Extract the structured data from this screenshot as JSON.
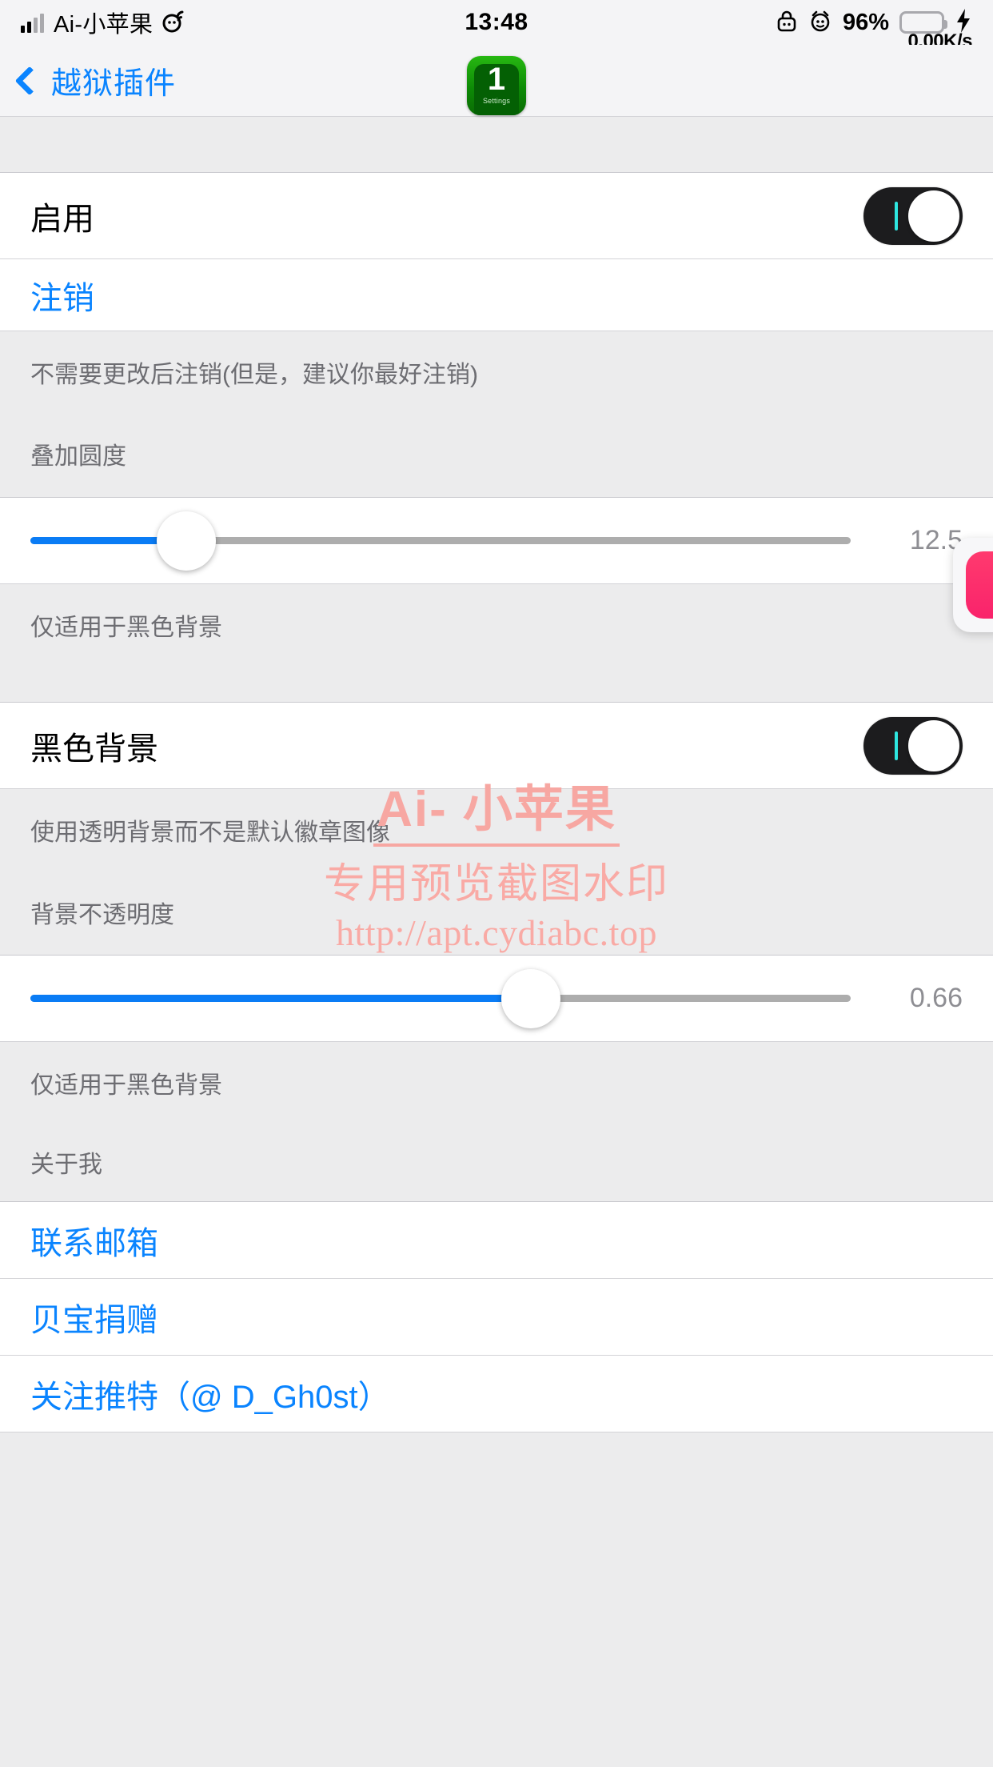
{
  "statusbar": {
    "carrier": "Ai-小苹果",
    "time": "13:48",
    "battery_percent": "96%",
    "network_speed": "0.00K/s",
    "icons": {
      "signal": "signal-bars-icon",
      "wifi": "wifi-icon",
      "lock": "rotation-lock-icon",
      "alarm": "alarm-clock-icon",
      "charging": "lightning-bolt-icon"
    },
    "battery_color": "#4cd964"
  },
  "navbar": {
    "back_label": "越狱插件",
    "app_icon": {
      "badge": "1",
      "caption": "Settings"
    }
  },
  "rows": {
    "enable_label": "启用",
    "logout_label": "注销",
    "logout_footer": "不需要更改后注销(但是，建议你最好注销)",
    "corner_radius_header": "叠加圆度",
    "corner_radius_value": "12.5",
    "corner_radius_footer": "仅适用于黑色背景",
    "black_bg_label": "黑色背景",
    "black_bg_footer": "使用透明背景而不是默认徽章图像",
    "opacity_header": "背景不透明度",
    "opacity_value": "0.66",
    "opacity_footer": "仅适用于黑色背景",
    "about_header": "关于我",
    "email_label": "联系邮箱",
    "paypal_label": "贝宝捐赠",
    "twitter_label": "关注推特（@ D_Gh0st）"
  },
  "sliders": {
    "corner_radius_fill_pct": 19,
    "opacity_fill_pct": 61
  },
  "watermark": {
    "line1": "Ai- 小苹果",
    "line2": "专用预览截图水印",
    "line3": "http://apt.cydiabc.top",
    "color": "#f8a9a4"
  },
  "colors": {
    "accent_blue": "#0a84ff",
    "slider_blue": "#0a7cf5",
    "toggle_on_track": "#1c1c1e",
    "toggle_tick": "#2ee6e0",
    "group_bg": "#ececed",
    "cell_bg": "#ffffff",
    "secondary_text": "#6d6d72",
    "float_widget": "#f9236b"
  }
}
